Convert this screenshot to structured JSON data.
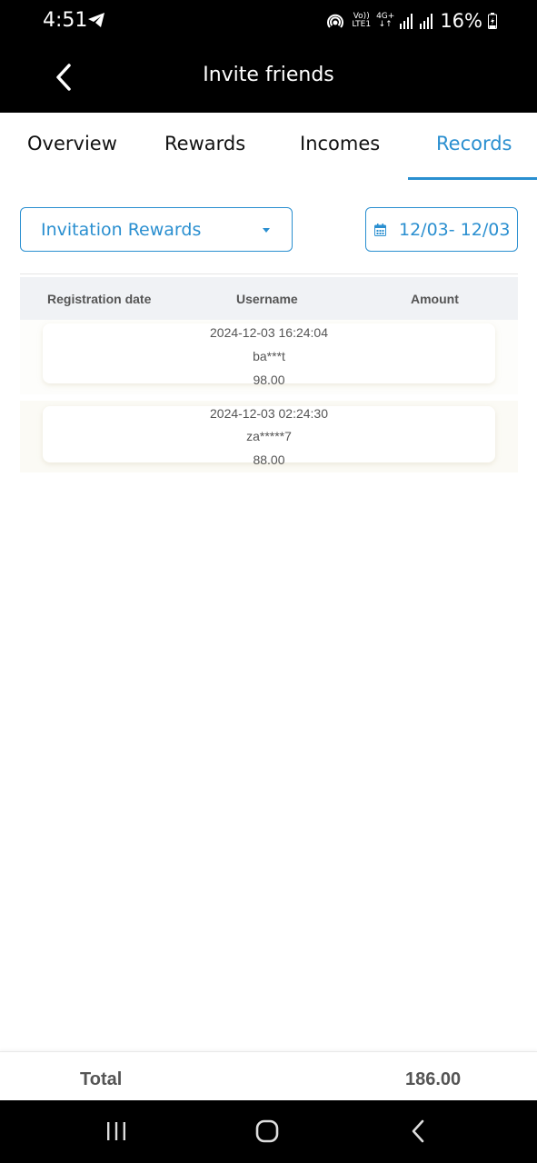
{
  "status_bar": {
    "time": "4:51",
    "network_top": "Vo))",
    "network_bottom": "LTE1",
    "network_type": "4G+",
    "battery": "16%"
  },
  "app_bar": {
    "title": "Invite friends",
    "back_icon": "chevron-left-icon"
  },
  "tabs": [
    {
      "label": "Overview",
      "active": false
    },
    {
      "label": "Rewards",
      "active": false
    },
    {
      "label": "Incomes",
      "active": false
    },
    {
      "label": "Records",
      "active": true
    }
  ],
  "filters": {
    "type_select": "Invitation Rewards",
    "date_range": "12/03- 12/03"
  },
  "table": {
    "columns": [
      "Registration date",
      "Username",
      "Amount"
    ],
    "rows": [
      {
        "date": "2024-12-03 16:24:04",
        "username": "ba***t",
        "amount": "98.00"
      },
      {
        "date": "2024-12-03 02:24:30",
        "username": "za*****7",
        "amount": "88.00"
      }
    ]
  },
  "total": {
    "label": "Total",
    "value": "186.00"
  },
  "colors": {
    "accent": "#2a8fd0",
    "bar_background": "#000000",
    "header_background": "#f0f2f5"
  }
}
